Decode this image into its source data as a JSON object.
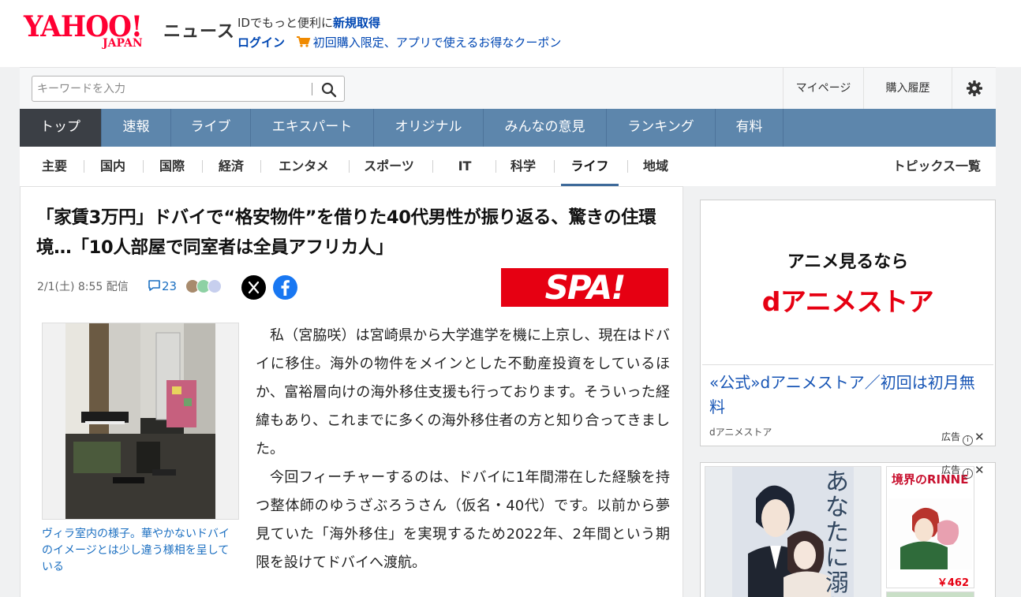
{
  "header": {
    "logo_main": "YAHOO!",
    "logo_sub": "JAPAN",
    "logo_section": "ニュース",
    "id_promo_text": "IDでもっと便利に",
    "id_register_link": "新規取得",
    "login_link": "ログイン",
    "coupon_text": "初回購入限定、アプリで使えるお得なクーポン"
  },
  "toolbar": {
    "search_placeholder": "キーワードを入力",
    "mypage": "マイページ",
    "purchase_history": "購入履歴"
  },
  "global_nav": {
    "items": [
      "トップ",
      "速報",
      "ライブ",
      "エキスパート",
      "オリジナル",
      "みんなの意見",
      "ランキング",
      "有料"
    ],
    "active": "トップ"
  },
  "sub_nav": {
    "items": [
      "主要",
      "国内",
      "国際",
      "経済",
      "エンタメ",
      "スポーツ",
      "IT",
      "科学",
      "ライフ",
      "地域"
    ],
    "active": "ライフ",
    "topics_link": "トピックス一覧"
  },
  "article": {
    "title": "「家賃3万円」ドバイで“格安物件”を借りた40代男性が振り返る、驚きの住環境…「10人部屋で同室者は全員アフリカ人」",
    "date": "2/1(土) 8:55",
    "delivered": "配信",
    "comment_count": "23",
    "source_logo": "SPA!",
    "photo_caption": "ヴィラ室内の様子。華やかないドバイのイメージとは少し違う様相を呈している",
    "paragraphs": [
      "私（宮脇咲）は宮崎県から大学進学を機に上京し、現在はドバイに移住。海外の物件をメインとした不動産投資をしているほか、富裕層向けの海外移住支援も行っております。そういった経緯もあり、これまでに多くの海外移住者の方と知り合ってきました。",
      "今回フィーチャーするのは、ドバイに1年間滞在した経験を持つ整体師のゆうざぶろうさん（仮名・40代）です。以前から夢見ていた「海外移住」を実現するため2022年、2年間という期限を設けてドバイへ渡航。"
    ]
  },
  "ad1": {
    "banner_line1": "アニメ見るなら",
    "banner_line2": "dアニメストア",
    "headline": "«公式»dアニメストア／初回は初月無料",
    "advertiser": "dアニメストア",
    "ad_label": "広告"
  },
  "ad2": {
    "ad_label": "広告",
    "book1_cover_text": "あなたに溺れ",
    "book2_title": "境界のRINNE",
    "book2_price": "￥462"
  },
  "colors": {
    "yahoo_red": "#ff0033",
    "nav_blue": "#5d86ac",
    "nav_active": "#3b3f45",
    "link_blue": "#1b6fc1",
    "spa_red": "#e60012"
  }
}
